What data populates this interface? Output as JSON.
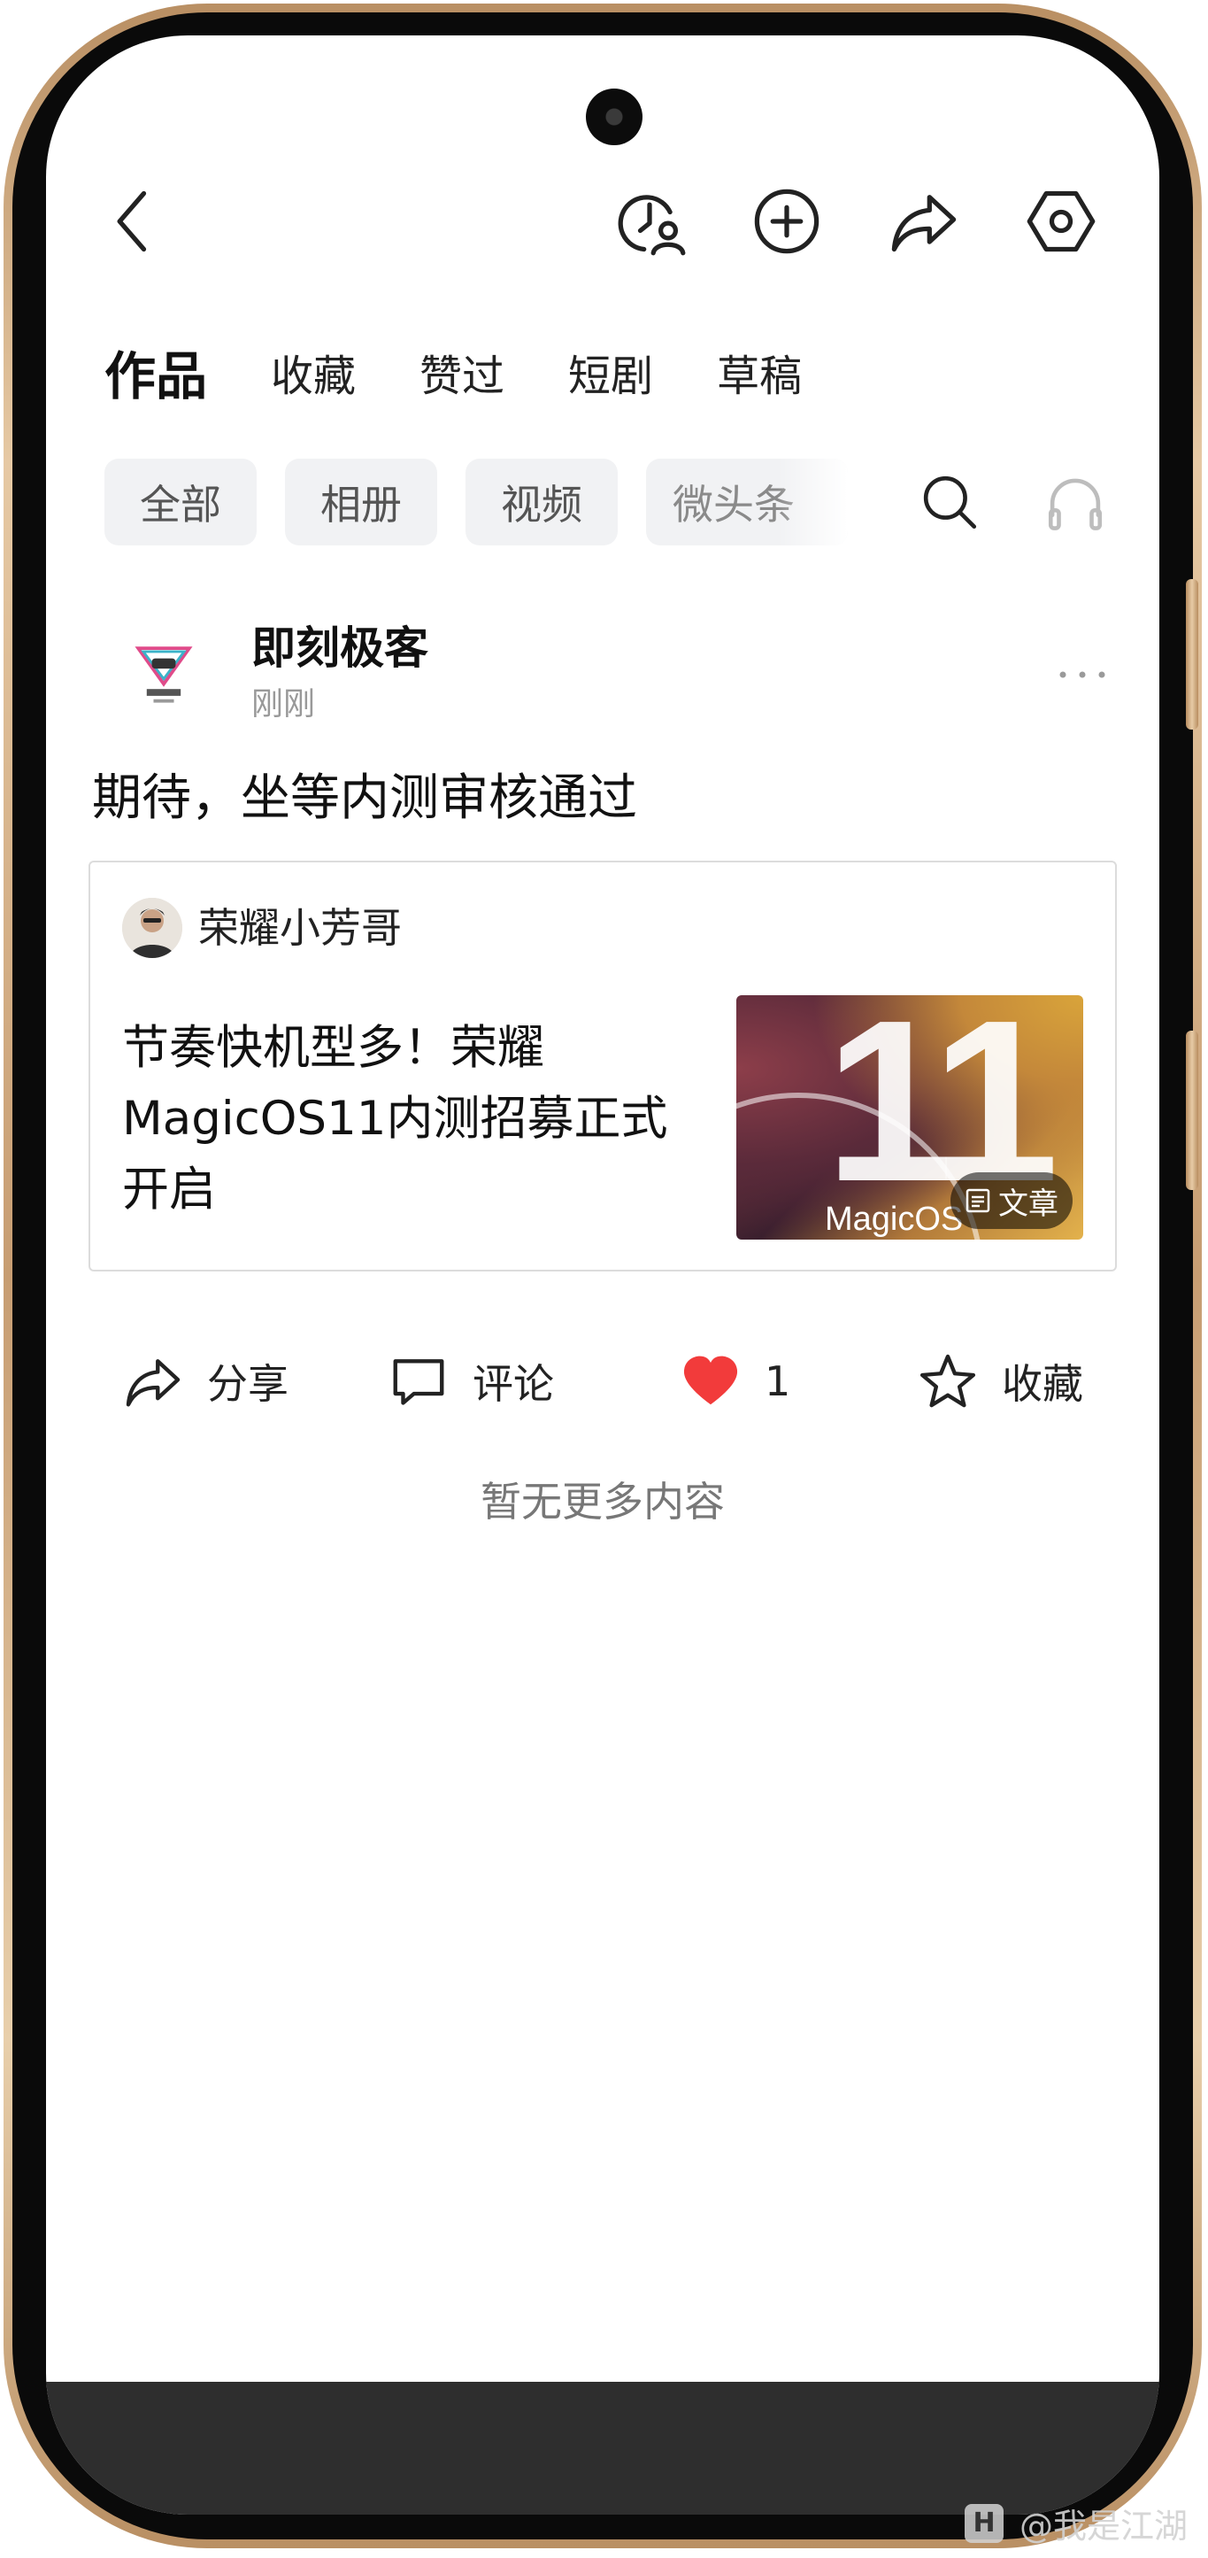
{
  "tabs": [
    {
      "label": "作品",
      "active": true
    },
    {
      "label": "收藏"
    },
    {
      "label": "赞过"
    },
    {
      "label": "短剧"
    },
    {
      "label": "草稿"
    }
  ],
  "filters": [
    "全部",
    "相册",
    "视频",
    "微头条"
  ],
  "post": {
    "author": "即刻极客",
    "time": "刚刚",
    "text": "期待，坐等内测审核通过",
    "quote": {
      "author": "荣耀小芳哥",
      "title": "节奏快机型多！荣耀MagicOS11内测招募正式开启",
      "thumb_number": "11",
      "thumb_brand": "MagicOS",
      "badge": "文章"
    },
    "actions": {
      "share": "分享",
      "comment": "评论",
      "like_count": "1",
      "favorite": "收藏"
    }
  },
  "no_more": "暂无更多内容",
  "watermark": "@我是江湖",
  "colors": {
    "like_red": "#f23b3b",
    "frame_gold": "#c79d72"
  }
}
